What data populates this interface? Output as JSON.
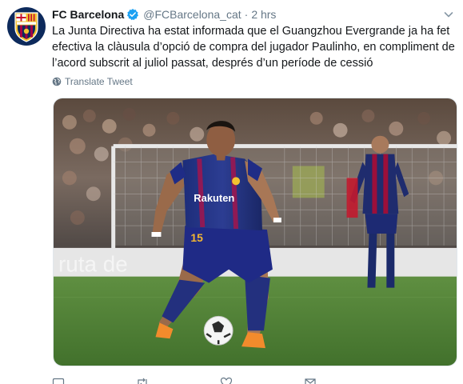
{
  "tweet": {
    "author_name": "FC Barcelona",
    "handle": "@FCBarcelona_cat",
    "separator": "·",
    "time": "2 hrs",
    "text_lines": [
      "La Junta Directiva ha estat informada que el Guangzhou Evergrande ja ha fet",
      "efectiva la clàusula d’opció de compra del jugador Paulinho, en compliment de",
      "l’acord subscrit al juliol passat, després d’un període de cessió"
    ],
    "translate_label": "Translate Tweet",
    "media": {
      "banner_text": "ruta de",
      "shirt_sponsor": "Rakuten",
      "shirt_number": "15"
    },
    "actions": [
      {
        "name": "reply",
        "icon": "reply-icon",
        "count": ""
      },
      {
        "name": "retweet",
        "icon": "retweet-icon",
        "count": ""
      },
      {
        "name": "like",
        "icon": "heart-icon",
        "count": ""
      },
      {
        "name": "message",
        "icon": "envelope-icon",
        "count": ""
      }
    ]
  },
  "colors": {
    "text": "#14171a",
    "secondary": "#657786",
    "verified": "#1da1f2",
    "barca_blue": "#0d2a5c",
    "barca_red": "#a50044",
    "pitch": "#4f7d36"
  }
}
